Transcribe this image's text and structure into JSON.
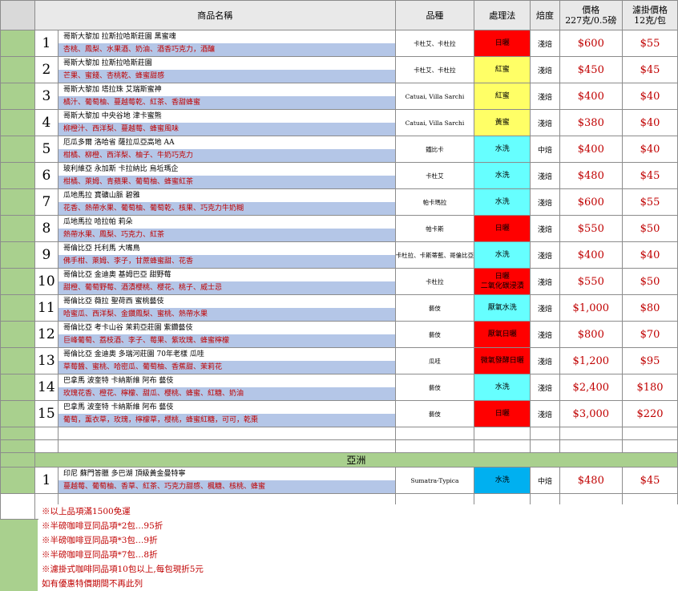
{
  "header": {
    "name": "商品名稱",
    "variety": "品種",
    "process": "處理法",
    "roast": "焙度",
    "price_label": "價格",
    "price_unit": "227克/0.5磅",
    "drip_label": "濾掛價格",
    "drip_unit": "12克/包"
  },
  "colors": {
    "sun_dried": "#ff0000",
    "honey_red": "#ffff66",
    "honey_yellow": "#ffff66",
    "washed": "#66ffff",
    "region_bar": "#a9d08e",
    "flavor_row": "#b4c6e7",
    "price_text": "#c00000"
  },
  "items": [
    {
      "no": "1",
      "name": "哥斯大黎加 拉斯拉哈斯莊園 黑蜜魂",
      "flavor": "杏桃、鳳梨、水果酒、奶油、酒香巧克力，酒釀",
      "variety": "卡杜艾、卡杜拉",
      "process": "日曬",
      "proc_color": "#ff0000",
      "roast": "淺焙",
      "price": "$600",
      "drip": "$55"
    },
    {
      "no": "2",
      "name": "哥斯大黎加 拉斯拉哈斯莊園",
      "flavor": "芒果、蜜餞、杏桃乾、蜂蜜甜感",
      "variety": "卡杜艾、卡杜拉",
      "process": "紅蜜",
      "proc_color": "#ffff66",
      "roast": "淺焙",
      "price": "$450",
      "drip": "$45"
    },
    {
      "no": "3",
      "name": "哥斯大黎加 塔拉珠 艾瑞斯蜜神",
      "flavor": "橘汁、葡萄柚、蔓越莓乾、紅茶、香甜蜂蜜",
      "variety": "Catuai, Villa Sarchi",
      "process": "紅蜜",
      "proc_color": "#ffff66",
      "roast": "淺焙",
      "price": "$400",
      "drip": "$40"
    },
    {
      "no": "4",
      "name": "哥斯大黎加 中央谷地 津卡蜜熊",
      "flavor": "柳橙汁、西洋梨、蔓越莓、蜂蜜風味",
      "variety": "Catuai, Villa Sarchi",
      "process": "黃蜜",
      "proc_color": "#ffff66",
      "roast": "淺焙",
      "price": "$380",
      "drip": "$40"
    },
    {
      "no": "5",
      "name": "厄瓜多爾 洛哈省 薩拉瓜亞高地 AA",
      "flavor": "柑橘、柳橙、西洋梨、柚子、牛奶巧克力",
      "variety": "鐵比卡",
      "process": "水洗",
      "proc_color": "#66ffff",
      "roast": "中焙",
      "price": "$400",
      "drip": "$40"
    },
    {
      "no": "6",
      "name": "玻利維亞 永加斯 卡拉納比 烏坵瑪企",
      "flavor": "柑橘、萊姆、青蘋果、葡萄柚、蜂蜜紅茶",
      "variety": "卡杜艾",
      "process": "水洗",
      "proc_color": "#66ffff",
      "roast": "淺焙",
      "price": "$480",
      "drip": "$45"
    },
    {
      "no": "7",
      "name": "瓜地馬拉  寶礦山脈 碧雅",
      "flavor": "花香、熱帶水果、葡萄柚、葡萄乾、核果、巧克力牛奶糊",
      "variety": "帕卡瑪拉",
      "process": "水洗",
      "proc_color": "#66ffff",
      "roast": "淺焙",
      "price": "$600",
      "drip": "$55"
    },
    {
      "no": "8",
      "name": "瓜地馬拉 哈拉帕 莉朵",
      "flavor": "熱帶水果、鳳梨、巧克力、紅茶",
      "variety": "帕卡斯",
      "process": "日曬",
      "proc_color": "#ff0000",
      "roast": "淺焙",
      "price": "$550",
      "drip": "$50"
    },
    {
      "no": "9",
      "name": "哥倫比亞 托利馬 大嘴鳥",
      "flavor": "佛手柑、萊姆、李子，甘蔗蜂蜜甜、花香",
      "variety": "卡杜拉、卡斯蒂藍、哥倫比亞",
      "process": "水洗",
      "proc_color": "#66ffff",
      "roast": "淺焙",
      "price": "$400",
      "drip": "$40"
    },
    {
      "no": "10",
      "name": "哥倫比亞 金迪奧 基姆巴亞 甜野莓",
      "flavor": "甜橙、葡萄野莓、酒漬櫻桃、櫻花、桃子、威士忌",
      "variety": "卡杜拉",
      "process": "日曬\n二氧化碳浸漬",
      "proc_color": "#ff0000",
      "roast": "淺焙",
      "price": "$550",
      "drip": "$50"
    },
    {
      "no": "11",
      "name": "哥倫比亞 薇拉 聖荷西 蜜桃藝伎",
      "flavor": "哈蜜瓜、西洋梨、金鑽鳳梨、蜜桃、熱帶水果",
      "variety": "藝伎",
      "process": "厭氧水洗",
      "proc_color": "#66ffff",
      "roast": "淺焙",
      "price": "$1,000",
      "drip": "$80"
    },
    {
      "no": "12",
      "name": "哥倫比亞 考卡山谷 茉莉亞莊園 紫鑽藝伎",
      "flavor": "巨峰葡萄、荔枝酒、李子、莓果、紫玫瑰、蜂蜜檸檬",
      "variety": "藝伎",
      "process": "厭氧日曬",
      "proc_color": "#ff0000",
      "roast": "淺焙",
      "price": "$800",
      "drip": "$70"
    },
    {
      "no": "13",
      "name": "哥倫比亞 金迪奧 多瑞河莊園 70年老樣 瓜哇",
      "flavor": "草莓醬、蜜桃、哈密瓜、葡萄柚、香蕉甜、茉莉花",
      "variety": "瓜哇",
      "process": "微氧發酵日曬",
      "proc_color": "#ff0000",
      "roast": "淺焙",
      "price": "$1,200",
      "drip": "$95"
    },
    {
      "no": "14",
      "name": "巴拿馬 波奎特 卡納斯維 阿布 藝伎",
      "flavor": "玫瑰花香、橙花、檸檬、甜瓜、櫻桃、蜂蜜、紅糖、奶油",
      "variety": "藝伎",
      "process": "水洗",
      "proc_color": "#66ffff",
      "roast": "淺焙",
      "price": "$2,400",
      "drip": "$180"
    },
    {
      "no": "15",
      "name": "巴拿馬 波奎特 卡納斯維 阿布 藝伎",
      "flavor": "葡萄，薰衣草，玫瑰，檸檬草，櫻桃，蜂蜜紅糖，可可，乾棗",
      "variety": "藝伎",
      "process": "日曬",
      "proc_color": "#ff0000",
      "roast": "淺焙",
      "price": "$3,000",
      "drip": "$220"
    }
  ],
  "region": "亞洲",
  "asia_items": [
    {
      "no": "1",
      "name": "印尼 蘇門答臘 多巴湖 頂級黃金曼特寧",
      "flavor": "蔓越莓、葡萄柚、香草、紅茶、巧克力甜感、楓糖、核桃、蜂蜜",
      "variety": "Sumatra-Typica",
      "process": "水洗",
      "proc_color": "#00b0f0",
      "roast": "中焙",
      "price": "$480",
      "drip": "$45"
    }
  ],
  "notes": [
    "※以上品項滿1500免運",
    "※半磅咖啡豆同品項*2包…95折",
    "※半磅咖啡豆同品項*3包…9折",
    "※半磅咖啡豆同品項*7包…8折",
    "※濾掛式咖啡同品項10包以上,每包現折5元",
    "如有優惠特價期間不再此列"
  ]
}
